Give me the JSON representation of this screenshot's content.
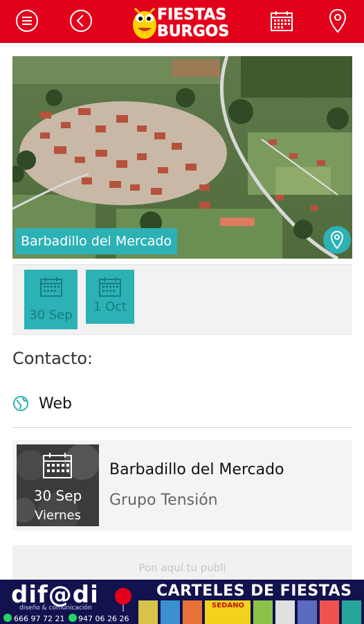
{
  "app": {
    "logo_line1": "FIESTAS",
    "logo_line2": "BURGOS"
  },
  "topbar": {
    "menu_icon": "hamburger-menu-icon",
    "back_icon": "back-arrow-icon",
    "calendar_icon": "calendar-icon",
    "location_icon": "map-pin-icon",
    "bg_color": "#e3001b"
  },
  "hero": {
    "title": "Barbadillo del Mercado",
    "accent_color": "#2cb1b5"
  },
  "dates": [
    {
      "label": "30 Sep"
    },
    {
      "label": "1 Oct"
    }
  ],
  "contact": {
    "title": "Contacto:",
    "web_label": "Web"
  },
  "event": {
    "date": "30 Sep",
    "weekday": "Viernes",
    "title": "Barbadillo del Mercado",
    "subtitle": "Grupo Tensión"
  },
  "publi": {
    "text": "Pon aquí tu publi"
  },
  "banner": {
    "brand": "dif@di",
    "brand_sub": "diseño & comunicación",
    "headline": "CARTELES DE FIESTAS",
    "phone1": "666 97 72 21",
    "phone2": "947 06 26 26",
    "poster_word": "SEDANO"
  }
}
